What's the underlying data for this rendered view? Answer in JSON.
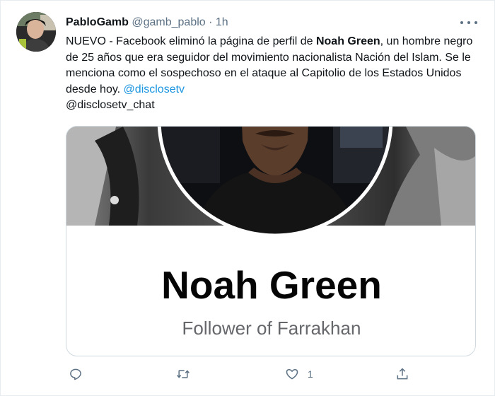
{
  "tweet": {
    "display_name": "PabloGamb",
    "handle": "@gamb_pablo",
    "separator": "·",
    "time": "1h",
    "text_parts": {
      "p1": "NUEVO - Facebook eliminó la página de perfil de ",
      "bold": "Noah Green",
      "p2": ", un hombre negro de 25 años que era seguidor del movimiento nacionalista Nación del Islam. Se le menciona como el sospechoso en el ataque al Capitolio de los Estados Unidos desde hoy. ",
      "mention1": "@disclosetv",
      "mention2": "@disclosetv_chat"
    }
  },
  "card": {
    "name": "Noah Green",
    "subtitle": "Follower of Farrakhan"
  },
  "actions": {
    "reply_icon": "reply-icon",
    "retweet_icon": "retweet-icon",
    "like_icon": "heart-icon",
    "like_count": "1",
    "share_icon": "share-icon"
  },
  "colors": {
    "link": "#1b95e0",
    "secondary": "#5b7083",
    "border": "#cfd9de"
  }
}
